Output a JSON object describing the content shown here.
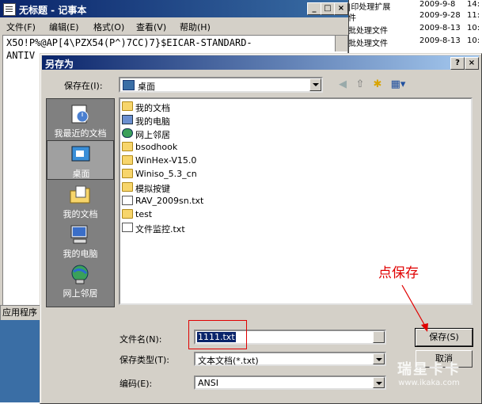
{
  "explorer_bg": {
    "rows": [
      {
        "name": "|印处理扩展",
        "date": "2009-9-8",
        "time": "14:"
      },
      {
        "name": "件",
        "date": "2009-9-28",
        "time": "11:"
      },
      {
        "name": "批处理文件",
        "date": "2009-8-13",
        "time": "10:"
      },
      {
        "name": "批处理文件",
        "date": "2009-8-13",
        "time": "10:"
      }
    ]
  },
  "notepad": {
    "title": "无标题 - 记事本",
    "menu": [
      "文件(F)",
      "编辑(E)",
      "格式(O)",
      "查看(V)",
      "帮助(H)"
    ],
    "line1": "X5O!P%@AP[4\\PZX54(P^)7CC)7}$EICAR-STANDARD-",
    "line2": "ANTIV"
  },
  "taskbar_text": "应用程序",
  "dialog": {
    "title": "另存为",
    "help_btn": "?",
    "close_btn": "×",
    "save_in_label": "保存在(I):",
    "save_in_value": "桌面",
    "places": [
      {
        "label": "我最近的文档",
        "icon": "recent-documents-icon"
      },
      {
        "label": "桌面",
        "icon": "desktop-icon"
      },
      {
        "label": "我的文档",
        "icon": "my-documents-icon"
      },
      {
        "label": "我的电脑",
        "icon": "my-computer-icon"
      },
      {
        "label": "网上邻居",
        "icon": "network-places-icon"
      }
    ],
    "files": [
      {
        "name": "我的文档",
        "icon": "my-documents-icon"
      },
      {
        "name": "我的电脑",
        "icon": "computer-icon"
      },
      {
        "name": "网上邻居",
        "icon": "network-icon"
      },
      {
        "name": "bsodhook",
        "icon": "folder-icon"
      },
      {
        "name": "WinHex-V15.0",
        "icon": "folder-icon"
      },
      {
        "name": "Winiso_5.3_cn",
        "icon": "folder-icon"
      },
      {
        "name": "模拟按键",
        "icon": "folder-icon"
      },
      {
        "name": "RAV_2009sn.txt",
        "icon": "text-file-icon"
      },
      {
        "name": "test",
        "icon": "folder-shortcut-icon"
      },
      {
        "name": "文件监控.txt",
        "icon": "text-file-icon"
      }
    ],
    "filename_label": "文件名(N):",
    "filename_value": "1111.txt",
    "filetype_label": "保存类型(T):",
    "filetype_value": "文本文档(*.txt)",
    "encoding_label": "编码(E):",
    "encoding_value": "ANSI",
    "save_btn": "保存(S)",
    "cancel_btn": "取消"
  },
  "annotation": "点保存",
  "watermark": {
    "line1": "瑞星卡卡",
    "line2": "www.ikaka.com"
  },
  "colors": {
    "title_active": "#0a246a",
    "annotation": "#e00000",
    "selection": "#0a246a"
  }
}
